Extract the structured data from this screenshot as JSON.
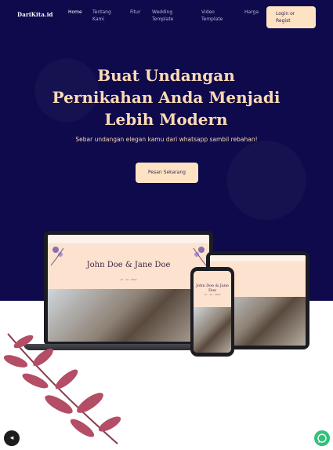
{
  "nav": {
    "brand": "DariKita.id",
    "items": [
      {
        "label": "Home"
      },
      {
        "label": "Tentang\nKami"
      },
      {
        "label": "Fitur"
      },
      {
        "label": "Wedding\nTemplate"
      },
      {
        "label": "Video\nTemplate"
      },
      {
        "label": "Harga"
      }
    ],
    "login_label": "Login or\nRegist"
  },
  "hero": {
    "headline": "Buat Undangan Pernikahan Anda Menjadi Lebih Modern",
    "subline": "Sebar undangan elegan kamu dari whatsapp sambil rebahan!",
    "cta_label": "Pesan Sekarang"
  },
  "mockup": {
    "couple": "John Doe & Jane Doe",
    "date": "21 · 10 · 2022"
  },
  "colors": {
    "hero_bg": "#0e0a4b",
    "accent": "#fde3c4",
    "headline": "#fcd9b4",
    "whatsapp": "#33c07a"
  }
}
